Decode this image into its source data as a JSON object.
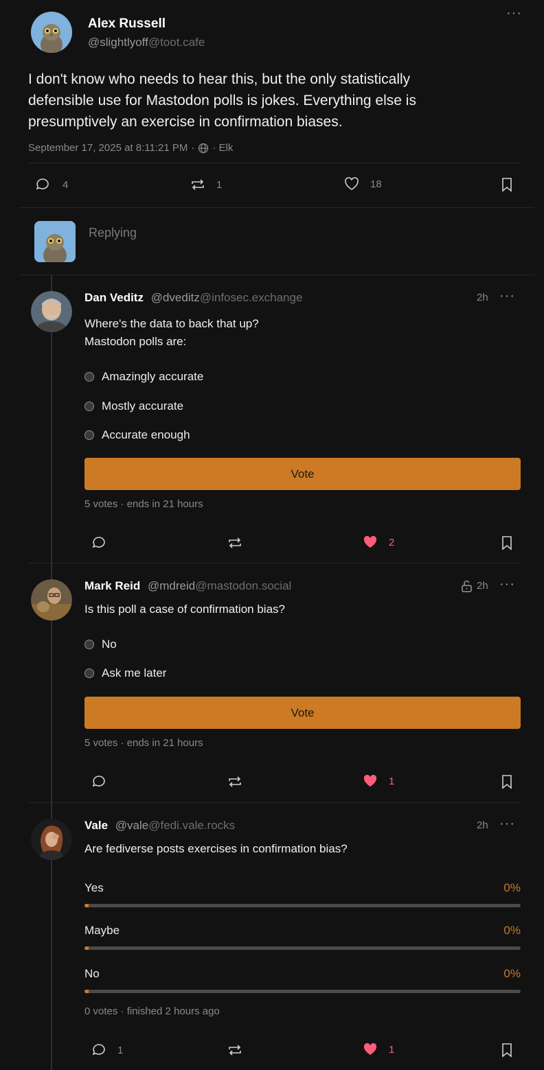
{
  "main_post": {
    "author_name": "Alex Russell",
    "author_handle": "@slightlyoff",
    "author_server": "@toot.cafe",
    "text_lines": [
      "I don't know who needs to hear this, but the only statistically",
      "defensible use for Mastodon polls is jokes. Everything else is",
      "presumptively an exercise in confirmation biases."
    ],
    "timestamp": "September 17, 2025 at 8:11:21 PM",
    "meta_sep1": "·",
    "meta_sep2": "· Elk",
    "replies_count": "4",
    "boosts_count": "1",
    "favs_count": "18"
  },
  "reply_box": {
    "placeholder": "Replying"
  },
  "replies": [
    {
      "author_name": "Dan Veditz",
      "author_handle": "@dveditz",
      "author_server": "@infosec.exchange",
      "time": "2h",
      "text_lines": [
        "Where's the data to back that up?",
        "Mastodon polls are:"
      ],
      "poll_options": [
        "Amazingly accurate",
        "Mostly accurate",
        "Accurate enough"
      ],
      "vote_label": "Vote",
      "poll_meta": "5 votes · ends in 21 hours",
      "replies_count": "",
      "boosts_count": "",
      "favs_count": "2"
    },
    {
      "author_name": "Mark Reid",
      "author_handle": "@mdreid",
      "author_server": "@mastodon.social",
      "time": "2h",
      "text_lines": [
        "Is this poll a case of confirmation bias?"
      ],
      "poll_options": [
        "No",
        "Ask me later"
      ],
      "vote_label": "Vote",
      "poll_meta": "5 votes · ends in 21 hours",
      "replies_count": "",
      "boosts_count": "",
      "favs_count": "1"
    },
    {
      "author_name": "Vale",
      "author_handle": "@vale",
      "author_server": "@fedi.vale.rocks",
      "time": "2h",
      "text_lines": [
        "Are fediverse posts exercises in confirmation bias?"
      ],
      "poll_results": [
        {
          "label": "Yes",
          "percent": "0%"
        },
        {
          "label": "Maybe",
          "percent": "0%"
        },
        {
          "label": "No",
          "percent": "0%"
        }
      ],
      "poll_meta": "0 votes · finished 2 hours ago",
      "replies_count": "1",
      "boosts_count": "",
      "favs_count": "1"
    }
  ],
  "colors": {
    "accent": "#cc7a24",
    "fav": "#ff5c7c",
    "background": "#121212"
  }
}
